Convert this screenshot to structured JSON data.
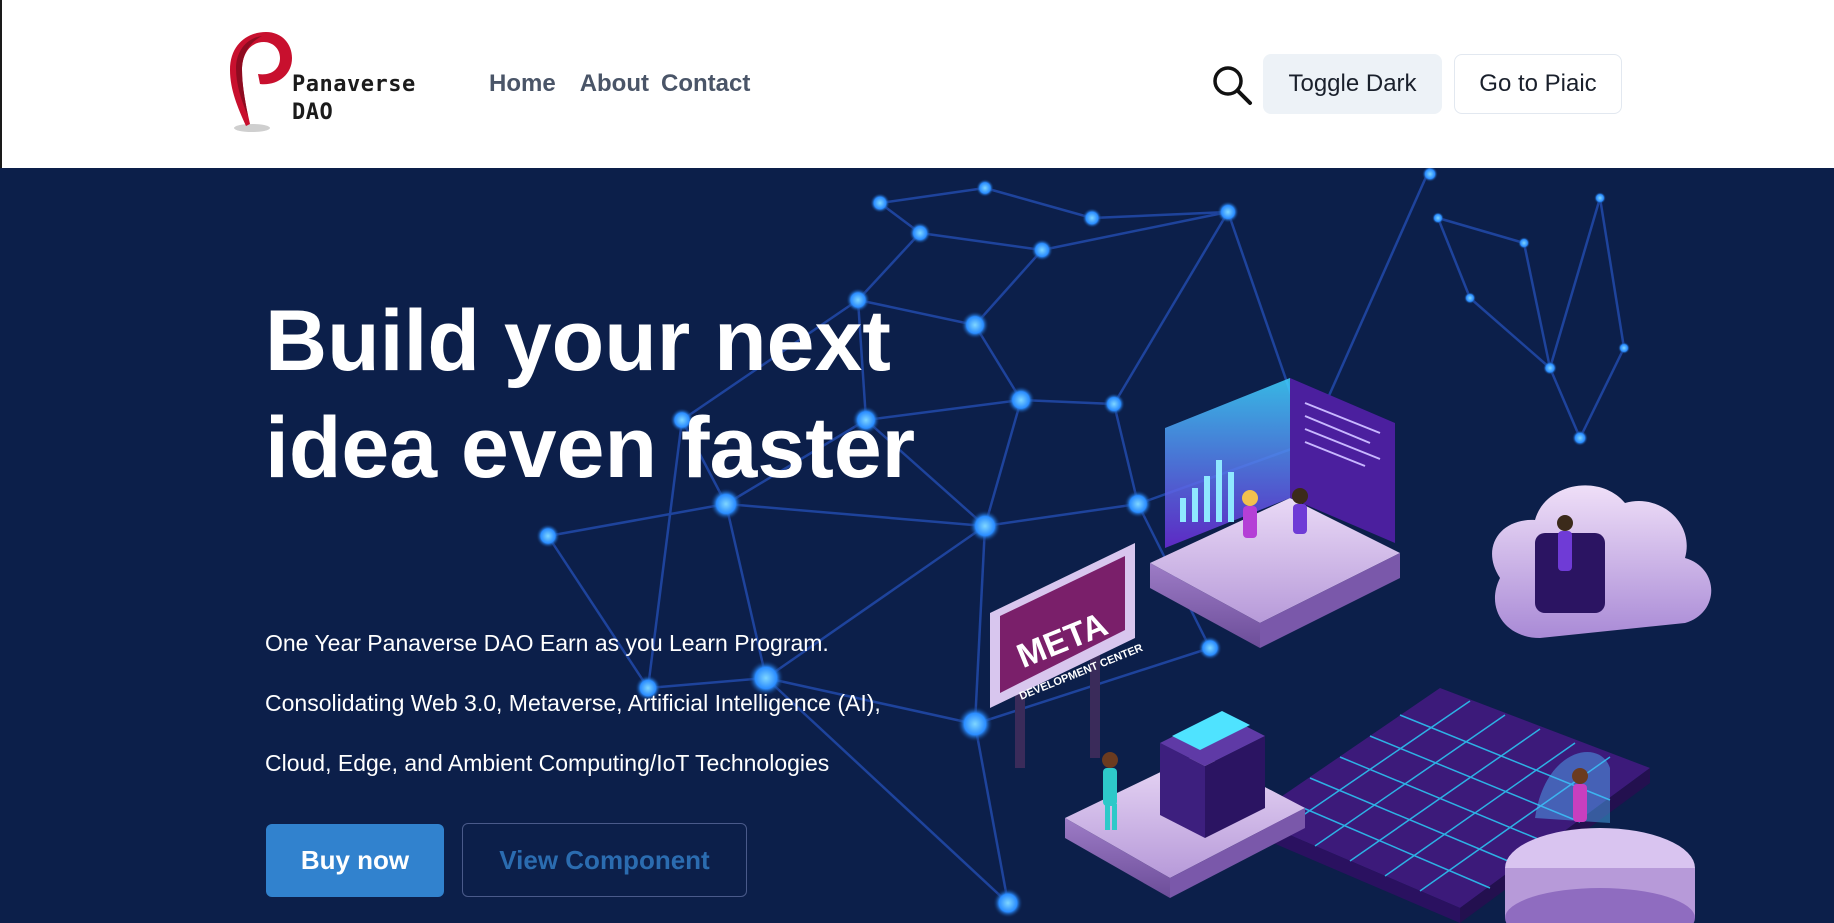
{
  "header": {
    "logo": {
      "line1": "Panaverse",
      "line2": "DAO"
    },
    "nav": [
      {
        "label": "Home"
      },
      {
        "label": "About"
      },
      {
        "label": "Contact"
      }
    ],
    "search_icon": "search-icon",
    "toggle_label": "Toggle Dark",
    "piaic_label": "Go to Piaic"
  },
  "hero": {
    "headline": "Build your next idea even faster",
    "lines": [
      "One Year Panaverse DAO Earn as you Learn Program.",
      "Consolidating Web 3.0, Metaverse, Artificial Intelligence (AI),",
      "Cloud, Edge, and Ambient Computing/IoT Technologies"
    ],
    "buy_label": "Buy now",
    "view_label": "View Component",
    "illustration": {
      "sign_title": "META",
      "sign_subtitle": "DEVELOPMENT CENTER"
    }
  },
  "colors": {
    "hero_bg": "#0c1f4a",
    "accent": "#3182ce",
    "nav_text": "#4a5568",
    "logo_red": "#c8102e"
  }
}
